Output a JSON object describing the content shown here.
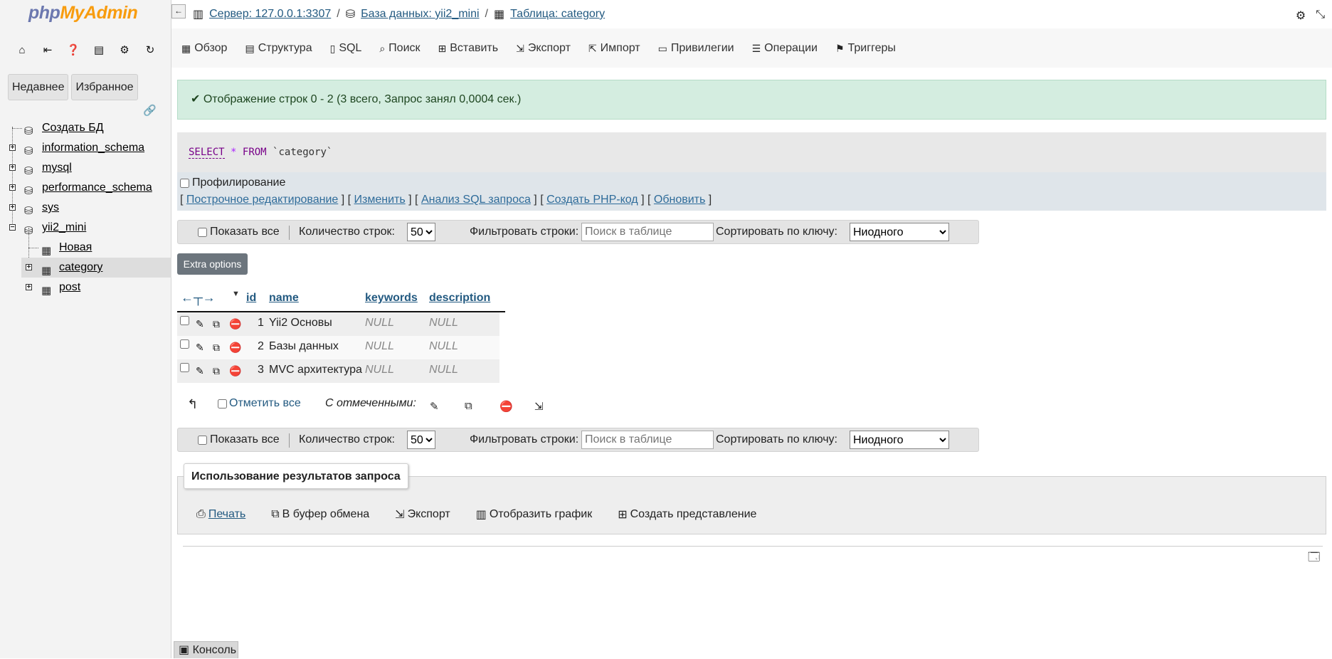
{
  "logo": {
    "part1": "php",
    "part2": "MyAdmin"
  },
  "sidebar": {
    "tabs": [
      "Недавнее",
      "Избранное"
    ],
    "tree": [
      {
        "label": "Создать БД"
      },
      {
        "label": "information_schema"
      },
      {
        "label": "mysql"
      },
      {
        "label": "performance_schema"
      },
      {
        "label": "sys"
      },
      {
        "label": "yii2_mini"
      },
      {
        "label": "Новая"
      },
      {
        "label": "category"
      },
      {
        "label": "post"
      }
    ]
  },
  "breadcrumb": {
    "server": "Сервер: 127.0.0.1:3307",
    "database": "База данных: yii2_mini",
    "table": "Таблица: category"
  },
  "menu": [
    "Обзор",
    "Структура",
    "SQL",
    "Поиск",
    "Вставить",
    "Экспорт",
    "Импорт",
    "Привилегии",
    "Операции",
    "Триггеры"
  ],
  "success_message": "Отображение строк 0 - 2 (3 всего, Запрос занял 0,0004 сек.)",
  "sql": {
    "select": "SELECT",
    "star": "*",
    "from": "FROM",
    "table": "`category`"
  },
  "profiling_label": "Профилирование",
  "query_links": [
    "Построчное редактирование",
    "Изменить",
    "Анализ SQL запроса",
    "Создать PHP-код",
    "Обновить"
  ],
  "nav": {
    "show_all": "Показать все",
    "rows_label": "Количество строк:",
    "rows_value": "50",
    "filter_label": "Фильтровать строки:",
    "filter_placeholder": "Поиск в таблице",
    "sort_label": "Сортировать по ключу:",
    "sort_value": "Ниодного"
  },
  "extra_options": "Extra options",
  "table": {
    "columns": [
      "id",
      "name",
      "keywords",
      "description"
    ],
    "rows": [
      {
        "id": "1",
        "name": "Yii2 Основы",
        "keywords": "NULL",
        "description": "NULL"
      },
      {
        "id": "2",
        "name": "Базы данных",
        "keywords": "NULL",
        "description": "NULL"
      },
      {
        "id": "3",
        "name": "MVC архитектура",
        "keywords": "NULL",
        "description": "NULL"
      }
    ]
  },
  "with_selected": {
    "check_all": "Отметить все",
    "label": "С отмеченными:"
  },
  "query_ops": {
    "legend": "Использование результатов запроса",
    "print": "Печать",
    "clipboard": "В буфер обмена",
    "export": "Экспорт",
    "chart": "Отобразить график",
    "view": "Создать представление"
  },
  "console": "Консоль",
  "colors": {
    "success_bg": "#d4ede0",
    "link": "#235a81",
    "extra_btn": "#6c757d"
  }
}
